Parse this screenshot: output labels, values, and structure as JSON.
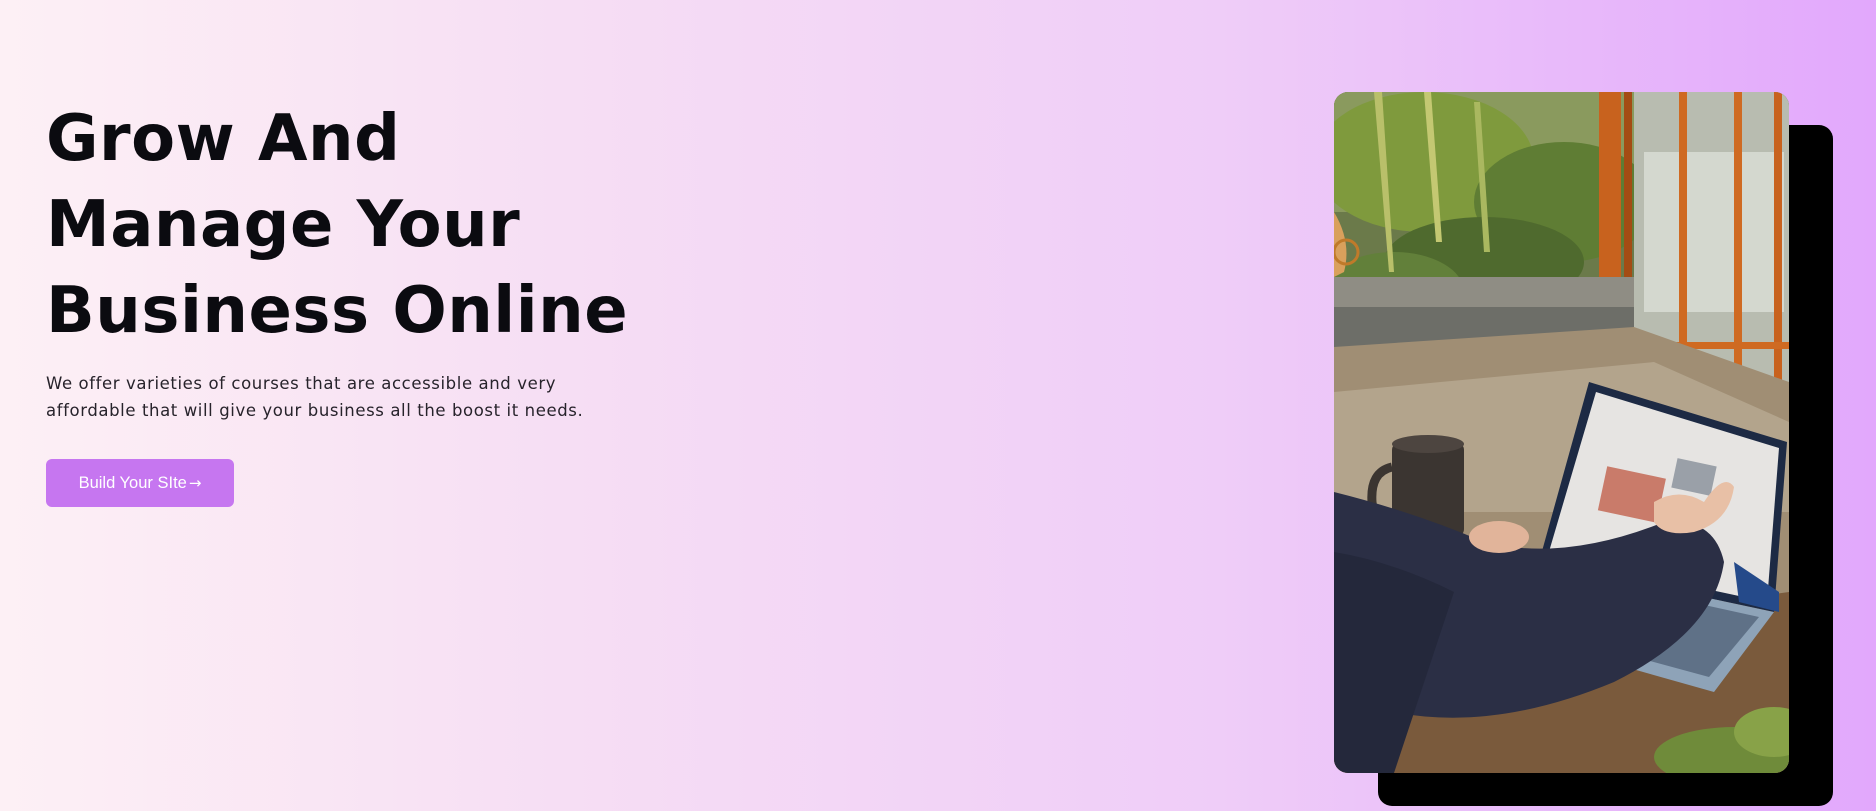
{
  "hero": {
    "title_lines": [
      "Grow And",
      "Manage Your",
      "Business Online"
    ],
    "subtitle": "We offer varieties of courses that are accessible and very affordable that will give your business all the boost it needs.",
    "cta_label": "Build Your SIte",
    "cta_icon": "arrow-right-icon",
    "cta_arrow_glyph": "→"
  },
  "image": {
    "description_icon": "photo-person-using-laptop"
  },
  "colors": {
    "background_start": "#fdf0f5",
    "background_end": "#e2a8fc",
    "cta_background": "#c676f0",
    "cta_text": "#ffffff",
    "title_text": "#0b0b10",
    "shadow": "#000000"
  }
}
